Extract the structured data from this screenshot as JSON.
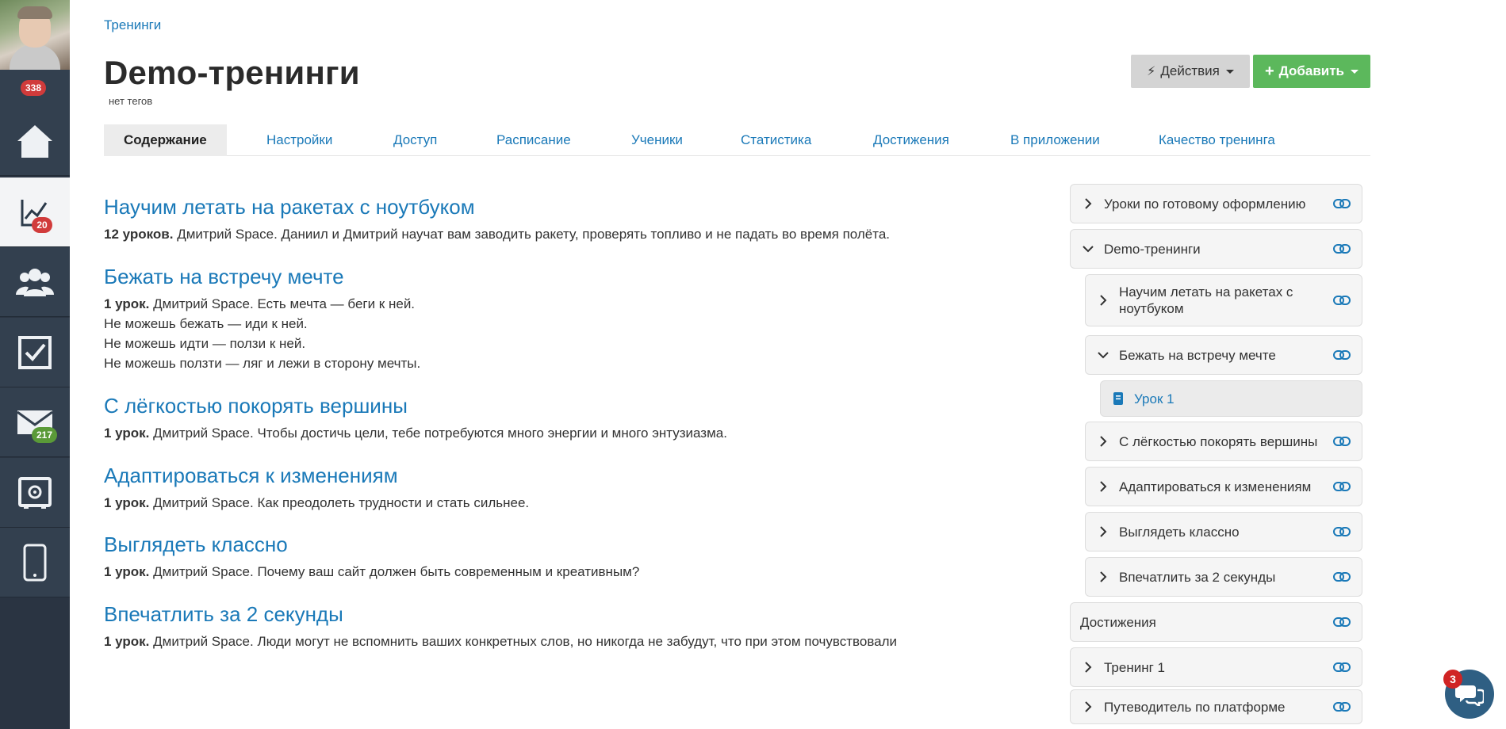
{
  "sidebar": {
    "badges": {
      "top": "338",
      "trainings": "20",
      "messages": "217"
    },
    "icons": [
      "home-icon",
      "chart-icon",
      "users-icon",
      "tasks-icon",
      "mail-icon",
      "safe-icon",
      "mobile-icon"
    ]
  },
  "header": {
    "breadcrumb": "Тренинги",
    "title": "Demo-тренинги",
    "tags": "нет тегов",
    "actions_label": "Действия",
    "add_label": "Добавить"
  },
  "tabs": [
    "Содержание",
    "Настройки",
    "Доступ",
    "Расписание",
    "Ученики",
    "Статистика",
    "Достижения",
    "В приложении",
    "Качество тренинга"
  ],
  "lessons": [
    {
      "title": "Научим летать на ракетах с ноутбуком",
      "count": "12 уроков.",
      "desc": [
        " Дмитрий Space. Даниил и Дмитрий научат вам заводить ракету, проверять топливо и не падать во время полёта."
      ]
    },
    {
      "title": "Бежать на встречу мечте",
      "count": "1 урок.",
      "desc": [
        " Дмитрий Space. Есть мечта — беги к ней.",
        "Не можешь бежать — иди к ней.",
        "Не можешь идти — ползи к ней.",
        "Не можешь ползти — ляг и лежи в сторону мечты."
      ]
    },
    {
      "title": "С лёгкостью покорять вершины",
      "count": "1 урок.",
      "desc": [
        " Дмитрий Space. Чтобы достичь цели, тебе потребуются много энергии и много энтузиазма."
      ]
    },
    {
      "title": "Адаптироваться к изменениям",
      "count": "1 урок.",
      "desc": [
        " Дмитрий Space. Как преодолеть трудности и стать сильнее."
      ]
    },
    {
      "title": "Выглядеть классно",
      "count": "1 урок.",
      "desc": [
        " Дмитрий Space. Почему ваш сайт должен быть современным и креативным?"
      ]
    },
    {
      "title": "Впечатлить за 2 секунды",
      "count": "1 урок.",
      "desc": [
        " Дмитрий Space. Люди могут не вспомнить ваших конкретных слов, но никогда не забудут, что при этом почувствовали"
      ]
    }
  ],
  "tree": {
    "items": [
      "Уроки по готовому оформлению",
      "Demo-тренинги",
      "Научим летать на ракетах с ноутбуком",
      "Бежать на встречу мечте",
      "Урок 1",
      "С лёгкостью покорять вершины",
      "Адаптироваться к изменениям",
      "Выглядеть классно",
      "Впечатлить за 2 секунды",
      "Достижения",
      "Тренинг 1",
      "Путеводитель по платформе"
    ]
  },
  "chat": {
    "badge": "3"
  },
  "colors": {
    "link": "#1a79b8",
    "add_button": "#5cb85c",
    "sidebar": "#2a3442",
    "badge_red": "#d13b3b",
    "badge_green": "#5a9a38"
  }
}
